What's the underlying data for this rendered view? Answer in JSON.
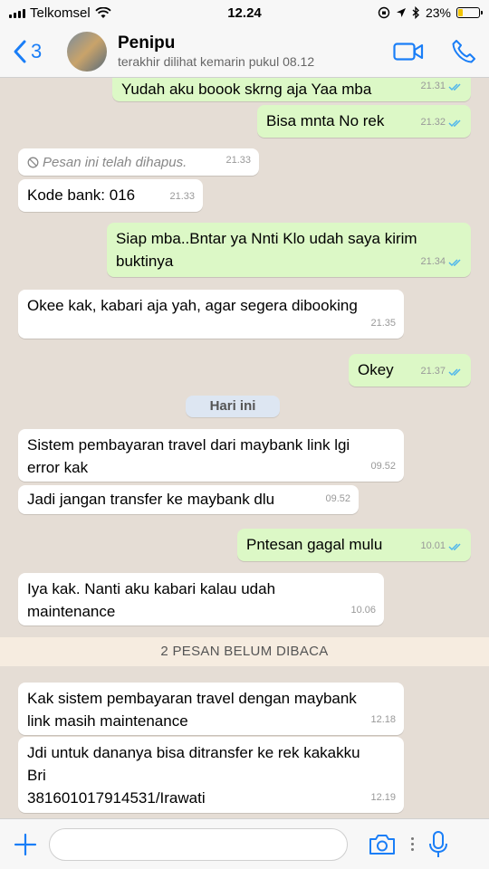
{
  "status_bar": {
    "carrier": "Telkomsel",
    "time": "12.24",
    "battery_percent": "23%",
    "battery_level": 0.23
  },
  "header": {
    "back_count": "3",
    "contact_name": "Penipu",
    "last_seen": "terakhir dilihat kemarin pukul 08.12"
  },
  "messages": [
    {
      "dir": "out",
      "text": "Yudah aku boook skrng aja Yaa mba",
      "time": "21.31",
      "read": true
    },
    {
      "dir": "out",
      "text": "Bisa mnta No rek",
      "time": "21.32",
      "read": true
    },
    {
      "dir": "in",
      "deleted": true,
      "text": "Pesan ini telah dihapus.",
      "time": "21.33"
    },
    {
      "dir": "in",
      "text": "Kode bank: 016",
      "time": "21.33"
    },
    {
      "dir": "out",
      "text": "Siap mba..Bntar ya Nnti Klo udah saya kirim\nbuktinya",
      "time": "21.34",
      "read": true
    },
    {
      "dir": "in",
      "text": "Okee kak, kabari aja yah, agar segera dibooking",
      "time": "21.35"
    },
    {
      "dir": "out",
      "text": "Okey",
      "time": "21.37",
      "read": true
    },
    {
      "dir": "in",
      "text": "Sistem pembayaran travel dari maybank link lgi\nerror kak",
      "time": "09.52"
    },
    {
      "dir": "in",
      "text": "Jadi jangan transfer ke maybank dlu",
      "time": "09.52"
    },
    {
      "dir": "out",
      "text": "Pntesan gagal mulu",
      "time": "10.01",
      "read": true
    },
    {
      "dir": "in",
      "text": "Iya kak. Nanti aku kabari kalau udah\nmaintenance",
      "time": "10.06"
    },
    {
      "dir": "in",
      "text": "Kak sistem pembayaran travel dengan maybank\nlink masih maintenance",
      "time": "12.18"
    },
    {
      "dir": "in",
      "text": "Jdi untuk dananya bisa ditransfer ke rek kakakku\nBri\n381601017914531/Irawati",
      "time": "12.19"
    }
  ],
  "day_separator": "Hari ini",
  "unread_banner": "2 PESAN BELUM DIBACA",
  "input": {
    "value": "",
    "placeholder": ""
  },
  "colors": {
    "accent": "#1a7ef7",
    "outgoing_bubble": "#dcf8c6",
    "incoming_bubble": "#ffffff",
    "read_ticks": "#4fb6ec",
    "chat_background": "#e5ddd5"
  }
}
